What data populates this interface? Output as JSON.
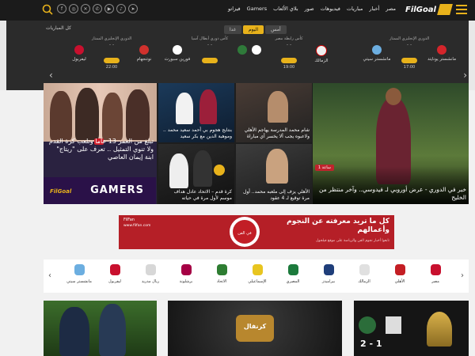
{
  "nav": {
    "logo_text": "FilGoal",
    "links": [
      "مصر",
      "أخبار",
      "مباريات",
      "فيديوهات",
      "صور",
      "بلاي الألعاب",
      "Gamers",
      "فيزاتو"
    ]
  },
  "matches": {
    "tabs": [
      "أمس",
      "اليوم",
      "غدا"
    ],
    "active_tab": "اليوم",
    "all_link": "كل المباريات",
    "items": [
      {
        "competition": "الدوري الإنجليزي الممتاز",
        "home": "مانشستر يونايتد",
        "away": "مانشستر سيتي",
        "time": "17:00",
        "home_color": "#d4252b",
        "away_color": "#6caee0"
      },
      {
        "competition": "كأس رابطة مصر",
        "home": "الزمالك",
        "away": "",
        "time": "19:00",
        "home_color": "#f4f4f4",
        "away_color": "#ffffff"
      },
      {
        "competition": "كأس دوري أبطال آسيا",
        "home": "",
        "away": "فورين سبورت",
        "time": "",
        "home_color": "#2f7a3a",
        "away_color": "#ffffff"
      },
      {
        "competition": "الدوري الإنجليزي الممتاز",
        "home": "نوتنجهام",
        "away": "ليفربول",
        "time": "22:00",
        "home_color": "#d0312d",
        "away_color": "#c8102e"
      }
    ]
  },
  "hero": {
    "main_tag": "1 ساعة",
    "main_caption": "خبر في الدوري - عرض أوروبي لـ فيدوسي.. وآخر منتظر من الخليج",
    "c1": "بنتايج هجوم بي أحمد سعيد محمد .. وموهبة الدين مع بكر سعيد",
    "c2": "شام محمد المدرسة يهاجم الأهلي ولاعبوه يجب ألا يخسر أي مباراة",
    "c3": "الأهلي يزف إلى ملعبه محمد.. أول مرة توقيع لـ 4 عقود",
    "c4": "كرة قدم – الاتحاد عادل هداف موسم لأول مرة في حياته",
    "gamers_caption": "تبلغ من العمر 13 عاما وتلعب كرة القدم ولا تنوي التمثيل .. تعرف على \"ريتاج\" ابنة إيمان العاصي",
    "gamers_title": "GAMERS",
    "gamers_logo": "FilGoal"
  },
  "ad": {
    "headline": "كل ما تريد معرفته عن النجوم وأعمالهم",
    "small_text": "تابعوا أخبار نجوم الفن والرياضة على موقع فيلجول",
    "brand": "FilFan",
    "url": "www.filfan.com",
    "badge_text": "في الفن"
  },
  "clubs": [
    {
      "name": "مصر",
      "color": "#c8102e"
    },
    {
      "name": "الأهلي",
      "color": "#c41e24"
    },
    {
      "name": "الزمالك",
      "color": "#e0e0e0"
    },
    {
      "name": "بيراميدز",
      "color": "#1f3e7a"
    },
    {
      "name": "المصري",
      "color": "#1c7a3c"
    },
    {
      "name": "الإسماعيلي",
      "color": "#e8c520"
    },
    {
      "name": "الاتحاد",
      "color": "#2e7d32"
    },
    {
      "name": "برشلونة",
      "color": "#a50044"
    },
    {
      "name": "ريال مدريد",
      "color": "#d7d7d7"
    },
    {
      "name": "ليفربول",
      "color": "#c8102e"
    },
    {
      "name": "مانشستر سيتي",
      "color": "#6caee0"
    }
  ],
  "bottom": {
    "game_title": "كرنفال",
    "score": "2 - 1"
  }
}
